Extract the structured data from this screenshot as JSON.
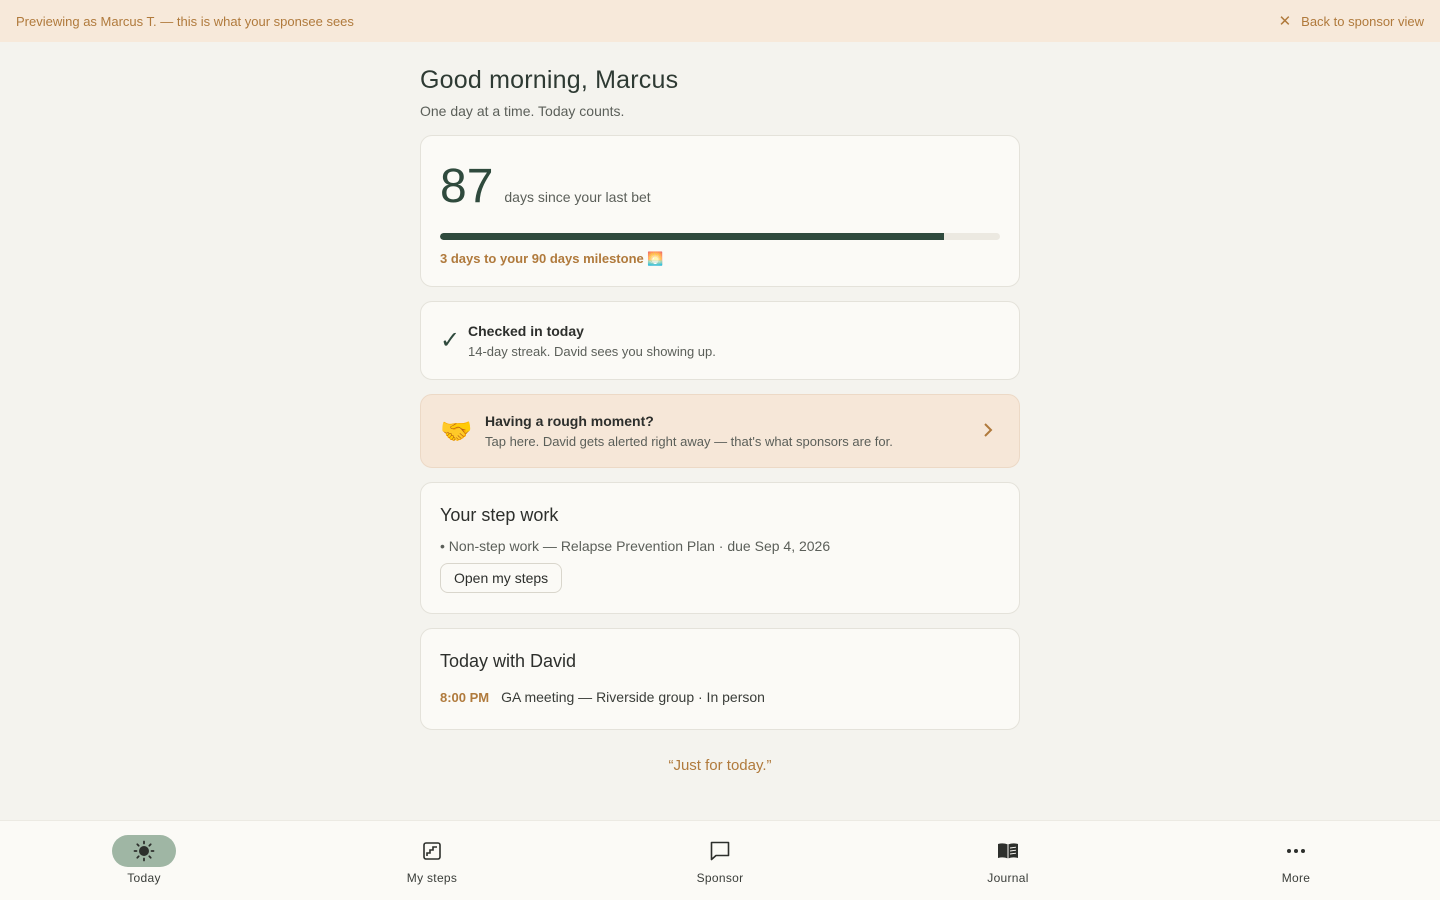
{
  "banner": {
    "text": "Previewing as Marcus T. — this is what your sponsee sees",
    "back_label": "Back to sponsor view"
  },
  "header": {
    "greeting": "Good morning, Marcus",
    "subtitle": "One day at a time. Today counts."
  },
  "streak": {
    "days": "87",
    "label": "days since your last bet",
    "progress_fraction": 0.9,
    "milestone": "3 days to your 90 days milestone 🌅"
  },
  "checkin": {
    "title": "Checked in today",
    "subtitle": "14-day streak. David sees you showing up."
  },
  "rough_moment": {
    "icon": "🤝",
    "title": "Having a rough moment?",
    "subtitle": "Tap here. David gets alerted right away — that's what sponsors are for."
  },
  "step_work": {
    "title": "Your step work",
    "item": "• Non-step work — Relapse Prevention Plan · due Sep 4, 2026",
    "button_label": "Open my steps"
  },
  "today_with": {
    "title": "Today with David",
    "event_time": "8:00 PM",
    "event_desc": "GA meeting — Riverside group · In person"
  },
  "quote": "“Just for today.”",
  "nav": {
    "items": [
      {
        "label": "Today",
        "icon": "sun-icon"
      },
      {
        "label": "My steps",
        "icon": "steps-icon"
      },
      {
        "label": "Sponsor",
        "icon": "chat-icon"
      },
      {
        "label": "Journal",
        "icon": "book-icon"
      },
      {
        "label": "More",
        "icon": "more-icon"
      }
    ]
  },
  "colors": {
    "accent": "#b07a3c",
    "primary": "#2f4a3d",
    "nav_active": "#9fb6a4"
  }
}
